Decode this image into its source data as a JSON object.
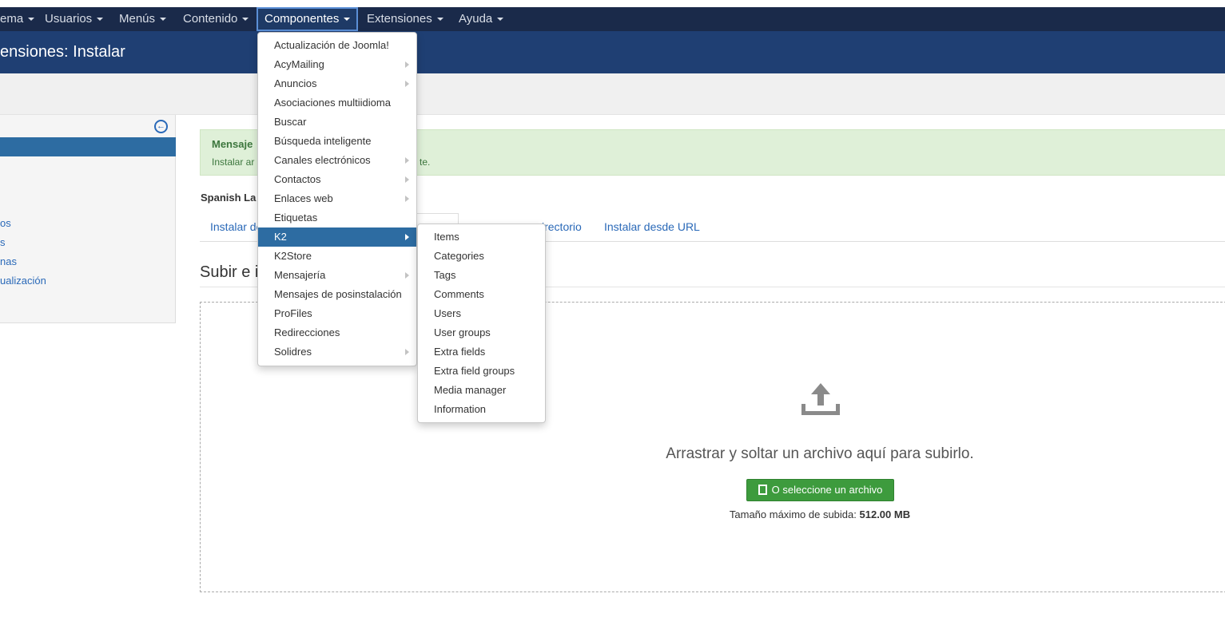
{
  "topnav": {
    "items": [
      {
        "label": "ema"
      },
      {
        "label": "Usuarios"
      },
      {
        "label": "Menús"
      },
      {
        "label": "Contenido"
      },
      {
        "label": "Componentes"
      },
      {
        "label": "Extensiones"
      },
      {
        "label": "Ayuda"
      }
    ]
  },
  "header": {
    "title": "ensiones: Instalar"
  },
  "sidebar": {
    "items": [
      {
        "label": "os"
      },
      {
        "label": "s"
      },
      {
        "label": "nas"
      },
      {
        "label": "ualización"
      }
    ]
  },
  "alert": {
    "heading": "Mensaje",
    "text_start": "Instalar ar",
    "text_end": "te."
  },
  "language_label": "Spanish La",
  "tabs": [
    {
      "label": "Instalar de"
    },
    {
      "label": "irectorio"
    },
    {
      "label": "Instalar desde URL"
    }
  ],
  "section_title": "Subir e i",
  "dropzone": {
    "text": "Arrastrar y soltar un archivo aquí para subirlo.",
    "button_label": "O seleccione un archivo",
    "max_label": "Tamaño máximo de subida:",
    "max_value": "512.00 MB"
  },
  "components_menu": {
    "items": [
      {
        "label": "Actualización de Joomla!",
        "submenu": false
      },
      {
        "label": "AcyMailing",
        "submenu": true
      },
      {
        "label": "Anuncios",
        "submenu": true
      },
      {
        "label": "Asociaciones multiidioma",
        "submenu": false
      },
      {
        "label": "Buscar",
        "submenu": false
      },
      {
        "label": "Búsqueda inteligente",
        "submenu": false
      },
      {
        "label": "Canales electrónicos",
        "submenu": true
      },
      {
        "label": "Contactos",
        "submenu": true
      },
      {
        "label": "Enlaces web",
        "submenu": true
      },
      {
        "label": "Etiquetas",
        "submenu": false
      },
      {
        "label": "K2",
        "submenu": true,
        "highlighted": true
      },
      {
        "label": "K2Store",
        "submenu": false
      },
      {
        "label": "Mensajería",
        "submenu": true
      },
      {
        "label": "Mensajes de posinstalación",
        "submenu": false
      },
      {
        "label": "ProFiles",
        "submenu": false
      },
      {
        "label": "Redirecciones",
        "submenu": false
      },
      {
        "label": "Solidres",
        "submenu": true
      }
    ]
  },
  "k2_menu": {
    "items": [
      {
        "label": "Items"
      },
      {
        "label": "Categories"
      },
      {
        "label": "Tags"
      },
      {
        "label": "Comments"
      },
      {
        "label": "Users"
      },
      {
        "label": "User groups"
      },
      {
        "label": "Extra fields"
      },
      {
        "label": "Extra field groups"
      },
      {
        "label": "Media manager"
      },
      {
        "label": "Information"
      }
    ]
  },
  "colors": {
    "navbar": "#1a2a4a",
    "header": "#1f3f73",
    "highlight": "#2d6ca2",
    "success_bg": "#dff0d8",
    "button_green": "#3d9b3d",
    "link": "#2a69b8"
  }
}
